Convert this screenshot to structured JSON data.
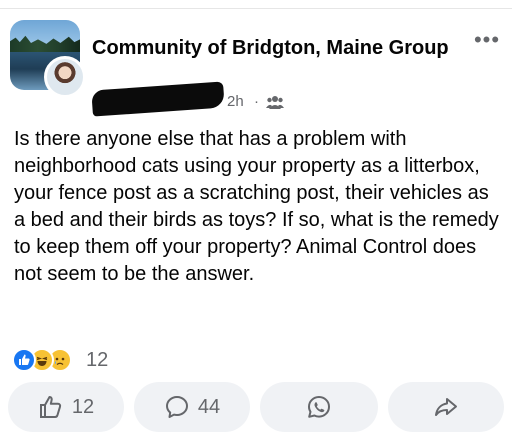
{
  "post": {
    "group_name": "Community of Bridgton, Maine Group",
    "more_label": "•••",
    "time": "2h",
    "meta_separator": "·",
    "text": "Is there anyone else that has a problem with neighborhood cats using your property as a litterbox, your fence post as a scratching post, their vehicles as a bed and their birds as toys? If so, what is the remedy to keep them off your property? Animal Control does not seem to be the answer."
  },
  "reactions": {
    "types": [
      "like-icon",
      "haha-icon",
      "sad-icon"
    ],
    "count": "12"
  },
  "actions": {
    "like_count": "12",
    "comment_count": "44",
    "whatsapp_icon": "whatsapp-icon",
    "share_icon": "share-icon"
  },
  "colors": {
    "text_primary": "#050505",
    "text_secondary": "#65676b",
    "pill_background": "#f0f2f5",
    "like_blue": "#1877f2",
    "emoji_yellow": "#f7c234"
  }
}
